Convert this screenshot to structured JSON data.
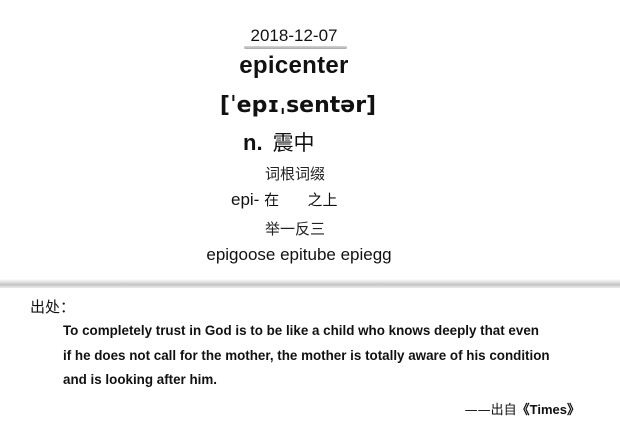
{
  "entry": {
    "date": "2018-12-07",
    "word": "epicenter",
    "phonetic": "[ˈepɪˌsentər]",
    "part_of_speech": "n.",
    "meaning": "震中",
    "root_heading": "词根词缀",
    "root_prefix": "epi-",
    "root_meaning_1": "在",
    "root_meaning_2": "之上",
    "examples_heading": "举一反三",
    "examples": "epigoose epitube epiegg"
  },
  "source": {
    "label": "出处：",
    "quote_lines": [
      "To completely trust in God is to be like a child who knows deeply that even",
      "if he does not call for the mother, the mother is totally aware of his condition",
      "and is looking after him."
    ],
    "attribution_prefix": "——出自",
    "attribution_title": "《Times》"
  }
}
